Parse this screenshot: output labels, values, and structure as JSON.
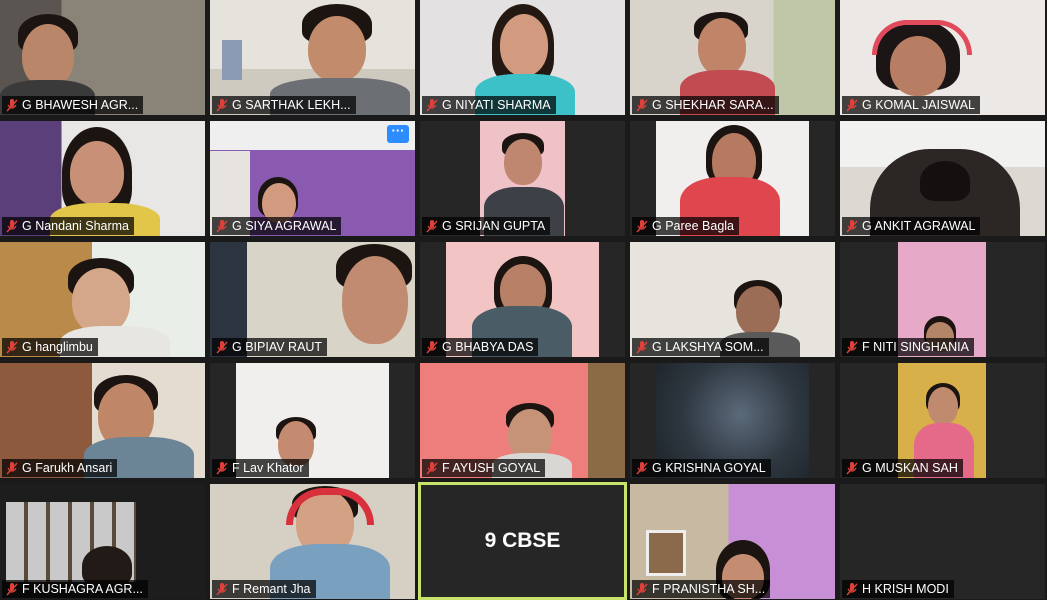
{
  "meeting": {
    "participants": [
      {
        "name": "G BHAWESH AGR..."
      },
      {
        "name": "G SARTHAK LEKH..."
      },
      {
        "name": "G NIYATI SHARMA"
      },
      {
        "name": "G SHEKHAR SARA..."
      },
      {
        "name": "G KOMAL JAISWAL"
      },
      {
        "name": "G Nandani Sharma"
      },
      {
        "name": "G SIYA AGRAWAL"
      },
      {
        "name": "G SRIJAN GUPTA"
      },
      {
        "name": "G Paree Bagla"
      },
      {
        "name": "G ANKIT AGRAWAL"
      },
      {
        "name": "G hanglimbu"
      },
      {
        "name": "G BIPIAV RAUT"
      },
      {
        "name": "G BHABYA DAS"
      },
      {
        "name": "G LAKSHYA SOM..."
      },
      {
        "name": "F NITI SINGHANIA"
      },
      {
        "name": "G Farukh Ansari"
      },
      {
        "name": "F Lav Khator"
      },
      {
        "name": "F AYUSH GOYAL"
      },
      {
        "name": "G KRISHNA GOYAL"
      },
      {
        "name": "G MUSKAN SAH"
      },
      {
        "name": "F KUSHAGRA AGR..."
      },
      {
        "name": "F Remant Jha"
      },
      {
        "name": "9 CBSE"
      },
      {
        "name": "F PRANISTHA SH..."
      },
      {
        "name": "H KRISH MODI"
      }
    ],
    "more_button_label": "···",
    "accent_color": "#2d8cff",
    "active_speaker_border": "#c7e36b",
    "muted_icon_color": "#e0403a"
  }
}
